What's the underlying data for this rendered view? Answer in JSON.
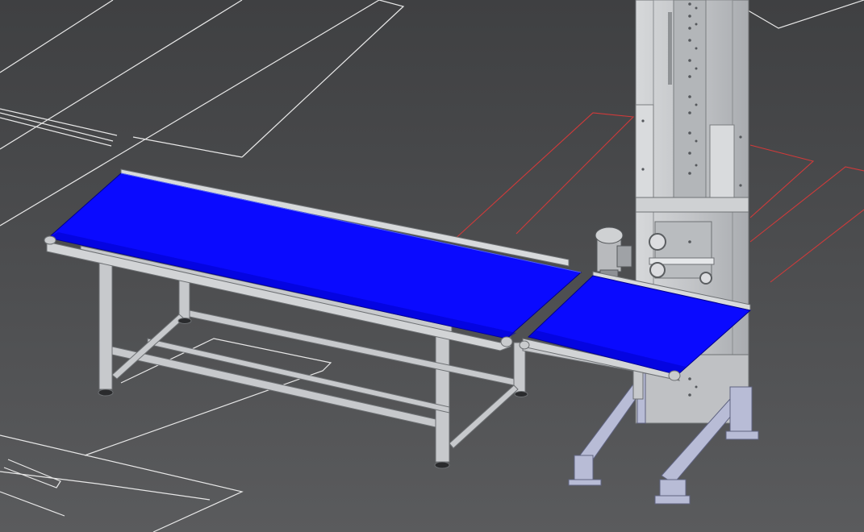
{
  "viewport": {
    "background_top": "#3f4042",
    "background_bottom": "#5a5b5d",
    "grid_line_color": "#e8e8e8",
    "highlight_line_color": "#d03a3a"
  },
  "scene": {
    "belt_color": "#0a0aff",
    "belt_shade_color": "#0000c8",
    "frame_color": "#c9cbcd",
    "frame_shade_color": "#9ea1a4",
    "tower_color": "#c3c5c8",
    "support_color": "#b8bcd6",
    "objects": [
      "long-belt-conveyor",
      "short-belt-conveyor",
      "vertical-lift-tower",
      "drive-motor",
      "angled-support-brackets"
    ]
  }
}
